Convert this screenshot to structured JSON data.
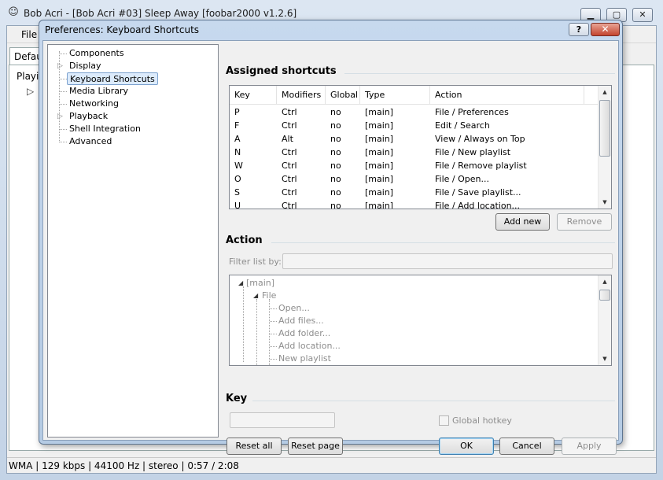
{
  "main_window": {
    "title": "Bob Acri - [Bob Acri #03] Sleep Away   [foobar2000 v1.2.6]",
    "menu_file": "File",
    "tab_label": "Default",
    "playlist_header": "Playi...",
    "play_indicator": "▷",
    "status": "WMA | 129 kbps | 44100 Hz | stereo | 0:57 / 2:08",
    "minimize": "▁",
    "maximize": "▢",
    "close": "✕"
  },
  "dialog": {
    "title": "Preferences: Keyboard Shortcuts",
    "help": "?",
    "close": "✕"
  },
  "tree": {
    "items": [
      {
        "label": "Components",
        "expandable": false
      },
      {
        "label": "Display",
        "expandable": true
      },
      {
        "label": "Keyboard Shortcuts",
        "expandable": false,
        "selected": true
      },
      {
        "label": "Media Library",
        "expandable": false
      },
      {
        "label": "Networking",
        "expandable": false
      },
      {
        "label": "Playback",
        "expandable": true
      },
      {
        "label": "Shell Integration",
        "expandable": false
      },
      {
        "label": "Advanced",
        "expandable": false
      }
    ]
  },
  "assigned": {
    "title": "Assigned shortcuts",
    "columns": [
      "Key",
      "Modifiers",
      "Global",
      "Type",
      "Action"
    ],
    "rows": [
      [
        "P",
        "Ctrl",
        "no",
        "[main]",
        "File / Preferences"
      ],
      [
        "F",
        "Ctrl",
        "no",
        "[main]",
        "Edit / Search"
      ],
      [
        "A",
        "Alt",
        "no",
        "[main]",
        "View / Always on Top"
      ],
      [
        "N",
        "Ctrl",
        "no",
        "[main]",
        "File / New playlist"
      ],
      [
        "W",
        "Ctrl",
        "no",
        "[main]",
        "File / Remove playlist"
      ],
      [
        "O",
        "Ctrl",
        "no",
        "[main]",
        "File / Open..."
      ],
      [
        "S",
        "Ctrl",
        "no",
        "[main]",
        "File / Save playlist..."
      ],
      [
        "U",
        "Ctrl",
        "no",
        "[main]",
        "File / Add location..."
      ]
    ],
    "add_new": "Add new",
    "remove": "Remove"
  },
  "action": {
    "title": "Action",
    "filter_label": "Filter list by:",
    "filter_value": "",
    "root": "[main]",
    "group": "File",
    "items": [
      "Open...",
      "Add files...",
      "Add folder...",
      "Add location...",
      "New playlist"
    ]
  },
  "key": {
    "title": "Key",
    "value": "",
    "global_hotkey": "Global hotkey"
  },
  "buttons": {
    "reset_all": "Reset all",
    "reset_page": "Reset page",
    "ok": "OK",
    "cancel": "Cancel",
    "apply": "Apply"
  },
  "icons": {
    "app": "alien-head-icon",
    "expand": "triangle-right-icon",
    "collapse": "triangle-down-icon"
  }
}
